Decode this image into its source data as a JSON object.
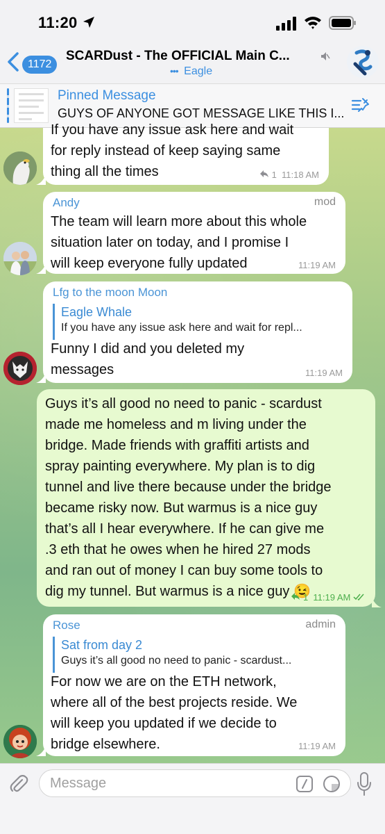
{
  "status_bar": {
    "time": "11:20"
  },
  "header": {
    "back_count": "1172",
    "title": "SCARDust - The OFFICIAL Main C...",
    "typing_dots": "•••",
    "typing_name": "Eagle"
  },
  "pinned": {
    "title": "Pinned Message",
    "text": "GUYS OF ANYONE GOT MESSAGE LIKE THIS I..."
  },
  "messages": [
    {
      "lines": [
        "If you have any issue ask here and wait",
        "for reply instead of keep saying same",
        "thing all the times"
      ],
      "replies": "1",
      "time": "11:18 AM"
    },
    {
      "sender": "Andy",
      "role": "mod",
      "lines": [
        "The team will learn more about this whole",
        "situation later on today, and I promise I",
        "will keep everyone fully updated"
      ],
      "time": "11:19 AM"
    },
    {
      "sender": "Lfg to the moon Moon",
      "reply_to": {
        "name": "Eagle Whale",
        "text": "If you have any issue ask here and wait for repl..."
      },
      "lines": [
        "Funny I did and you deleted my",
        "messages"
      ],
      "time": "11:19 AM"
    },
    {
      "outgoing": true,
      "lines": [
        "Guys it’s all good no need to panic - scardust",
        "made me homeless and m living under the",
        "bridge. Made friends with graffiti artists and",
        "spray painting everywhere. My plan is to dig",
        "tunnel and live there because under the bridge",
        "became risky now. But warmus is a nice guy",
        "that’s all I hear everywhere. If he can give me",
        ".3 eth that he owes when he hired 27 mods",
        "and ran out of money I can buy some tools to",
        "dig my tunnel. But warmus is a nice guy 😉"
      ],
      "replies": "1",
      "time": "11:19 AM"
    },
    {
      "sender": "Rose",
      "role": "admin",
      "reply_to": {
        "name": "Sat from day 2",
        "text": "Guys it’s all good no need to panic - scardust..."
      },
      "lines": [
        "For now we are on the ETH network,",
        "where all of the best projects reside. We",
        "will keep you updated if we decide to",
        "bridge elsewhere."
      ],
      "time": "11:19 AM"
    }
  ],
  "input": {
    "placeholder": "Message"
  },
  "colors": {
    "accent": "#3c8fe0",
    "outgoing_bubble": "#e7fad0",
    "check_green": "#4cae4c"
  }
}
